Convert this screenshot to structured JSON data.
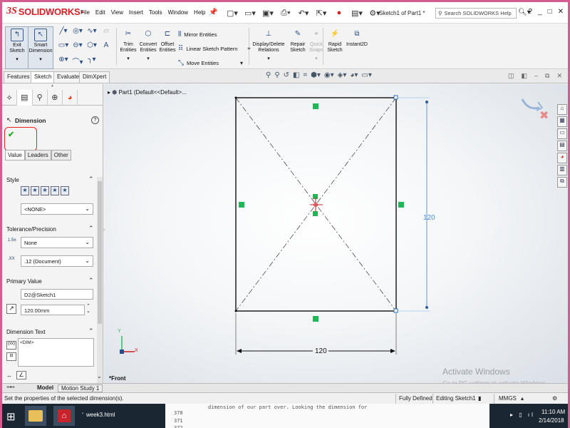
{
  "app": {
    "logo_ds": "3S",
    "logo_name": "SOLIDWORKS",
    "document_title": "Sketch1 of Part1 *",
    "search_placeholder": "Search SOLIDWORKS Help",
    "help_glyph": "?",
    "win_controls": [
      "_",
      "□",
      "✕"
    ]
  },
  "menu": [
    "File",
    "Edit",
    "View",
    "Insert",
    "Tools",
    "Window",
    "Help"
  ],
  "quick_access_icons": [
    "new-document-icon",
    "open-icon",
    "save-icon",
    "print-icon",
    "undo-icon",
    "select-icon",
    "traffic-light-icon",
    "options-list-icon",
    "gear-icon"
  ],
  "command_manager": {
    "exit_sketch": "Exit Sketch",
    "smart_dimension": "Smart Dimension",
    "trim_entities": "Trim Entities",
    "convert_entities": "Convert Entities",
    "offset_entities": "Offset Entities",
    "mirror_entities": "Mirror Entities",
    "linear_sketch_pattern": "Linear Sketch Pattern",
    "move_entities": "Move Entities",
    "display_delete_relations": "Display/Delete Relations",
    "repair_sketch": "Repair Sketch",
    "quick_snaps": "Quick Snaps",
    "rapid_sketch": "Rapid Sketch",
    "instant2d": "Instant2D"
  },
  "tabs": [
    "Features",
    "Sketch",
    "Evaluate",
    "DimXpert"
  ],
  "active_tab": "Sketch",
  "property_manager": {
    "title": "Dimension",
    "value_tabs": [
      "Value",
      "Leaders",
      "Other"
    ],
    "style_label": "Style",
    "style_value": "<NONE>",
    "tolerance_label": "Tolerance/Precision",
    "tolerance_value": "None",
    "precision_value": ".12 (Document)",
    "primary_value_label": "Primary Value",
    "primary_name": "D2@Sketch1",
    "primary_value": "120.00mm",
    "dimension_text_label": "Dimension Text",
    "dimension_text_value": "<DIM>"
  },
  "feature_tree": {
    "part_label": "Part1  (Default<<Default>..."
  },
  "view_label": "*Front",
  "sketch": {
    "width_dimension": "120",
    "height_dimension": "120"
  },
  "bottom_tabs": [
    "Model",
    "Motion Study 1"
  ],
  "watermark": {
    "line1": "Activate Windows",
    "line2": "Go to PC settings to activate Windows."
  },
  "status_bar": {
    "message": "Set the properties of the selected dimension(s).",
    "state": "Fully Defined",
    "mode": "Editing Sketch1",
    "units": "MMGS"
  },
  "taskbar": {
    "file_label": "week3.html",
    "editor_lines": [
      "370",
      "371",
      "372"
    ],
    "editor_snippet": "dimension of our part over. Looking the dimension for",
    "time": "11:10 AM",
    "date": "2/14/2018"
  },
  "colors": {
    "accent_red": "#d42027",
    "dim_blue": "#4a90d9",
    "relation_green": "#1db954",
    "frame_border": "#d35d8f"
  }
}
